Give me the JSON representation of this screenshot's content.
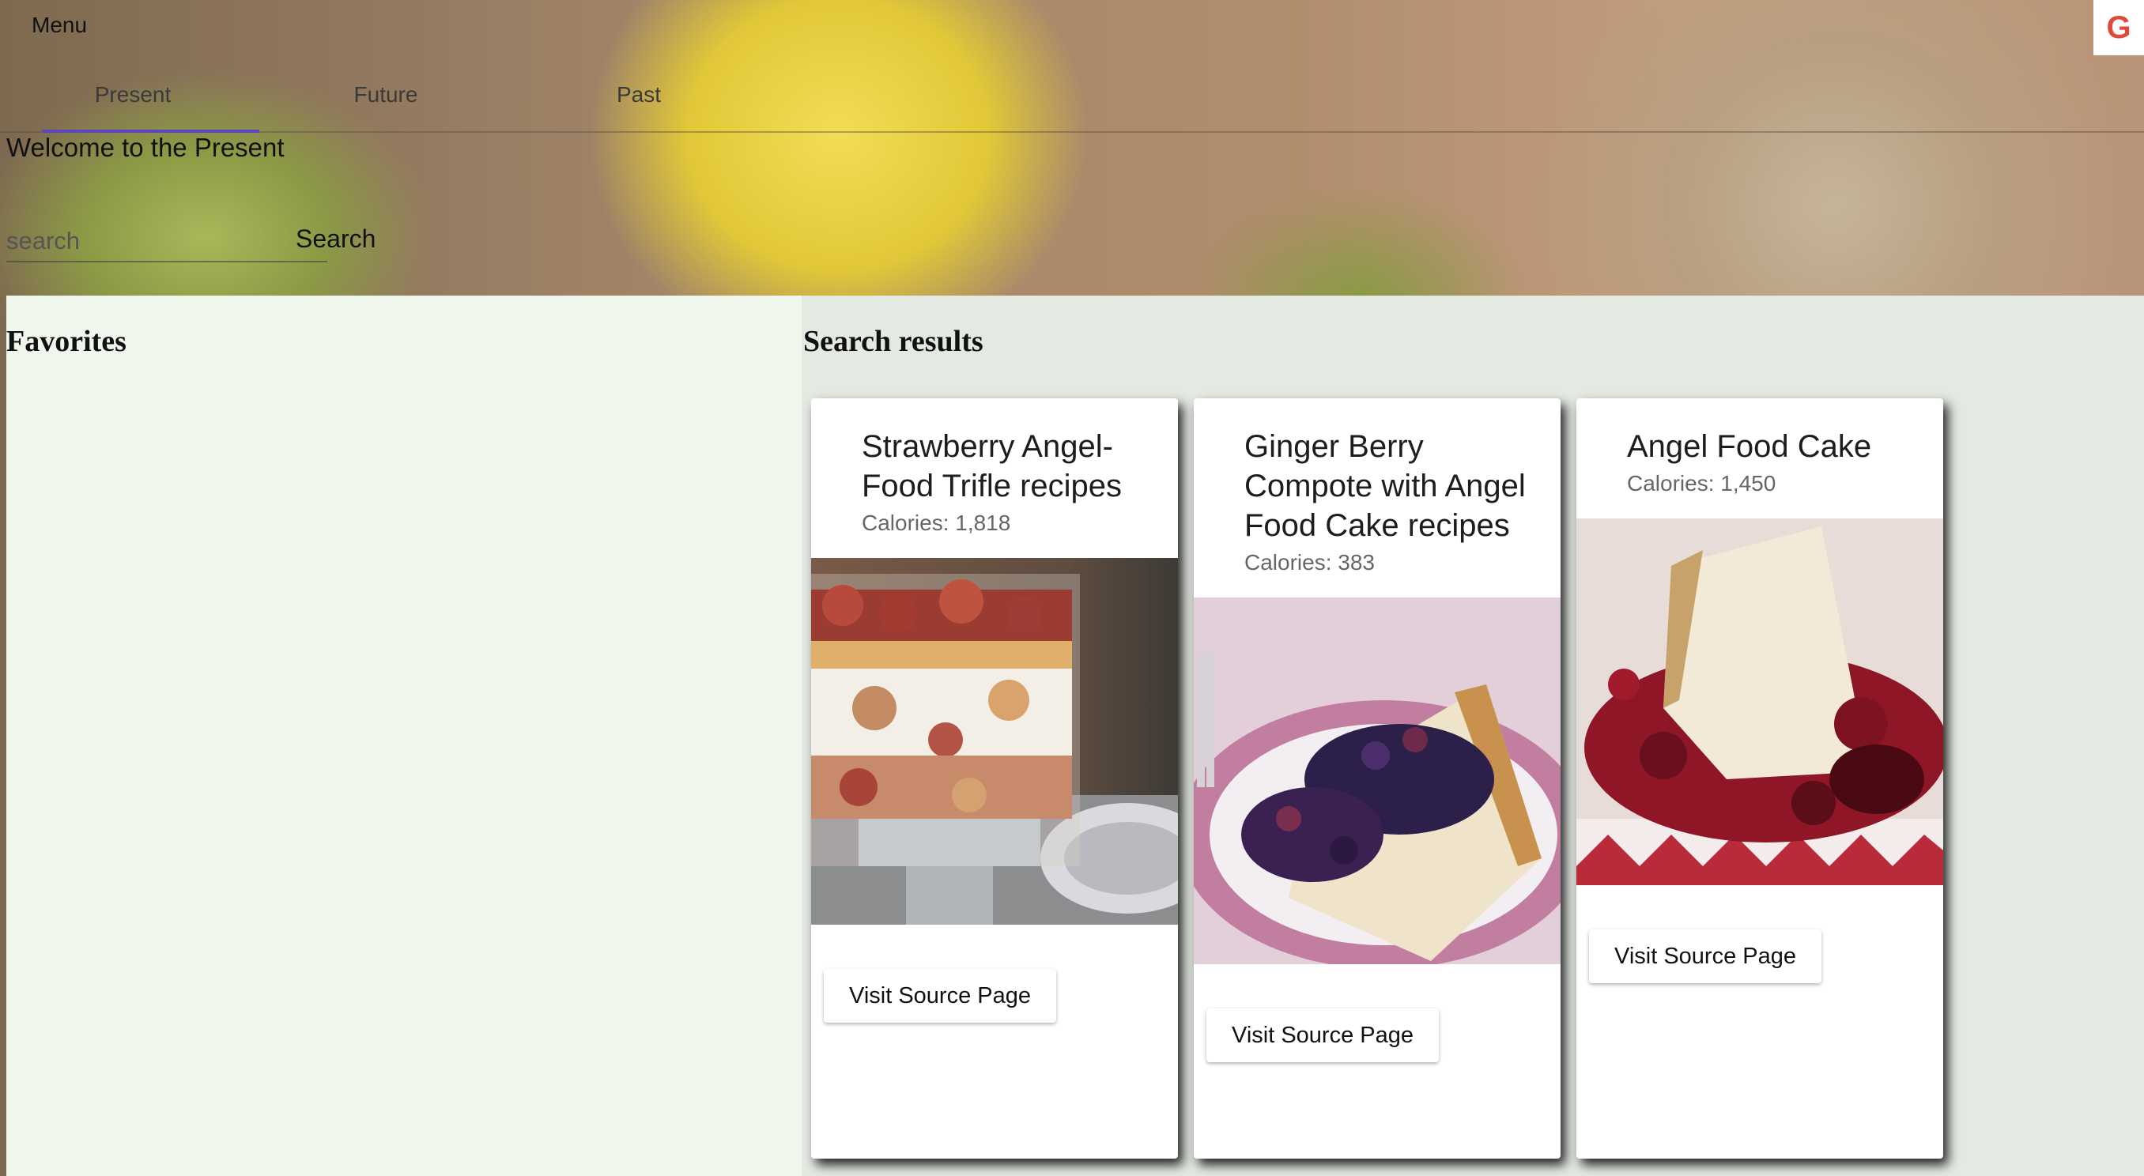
{
  "header": {
    "menu_label": "Menu",
    "badge_letter": "G"
  },
  "tabs": [
    {
      "label": "Present",
      "active": true
    },
    {
      "label": "Future",
      "active": false
    },
    {
      "label": "Past",
      "active": false
    }
  ],
  "welcome_text": "Welcome to the Present",
  "search": {
    "placeholder": "search",
    "value": "",
    "button_label": "Search"
  },
  "favorites": {
    "heading": "Favorites",
    "items": []
  },
  "results": {
    "heading": "Search results",
    "cards": [
      {
        "title": "Strawberry Angel-Food Trifle recipes",
        "calories": "Calories: 1,818",
        "image": "trifle-photo",
        "button_label": "Visit Source Page"
      },
      {
        "title": "Ginger Berry Compote with Angel Food Cake recipes",
        "calories": "Calories: 383",
        "image": "cake-compote-photo",
        "button_label": "Visit Source Page"
      },
      {
        "title": "Angel Food Cake",
        "calories": "Calories: 1,450",
        "image": "angel-cake-photo",
        "button_label": "Visit Source Page"
      }
    ]
  },
  "colors": {
    "tab_indicator": "#5c46c0",
    "favorites_bg": "#eff6ec",
    "results_bg": "#e4e9e2"
  }
}
